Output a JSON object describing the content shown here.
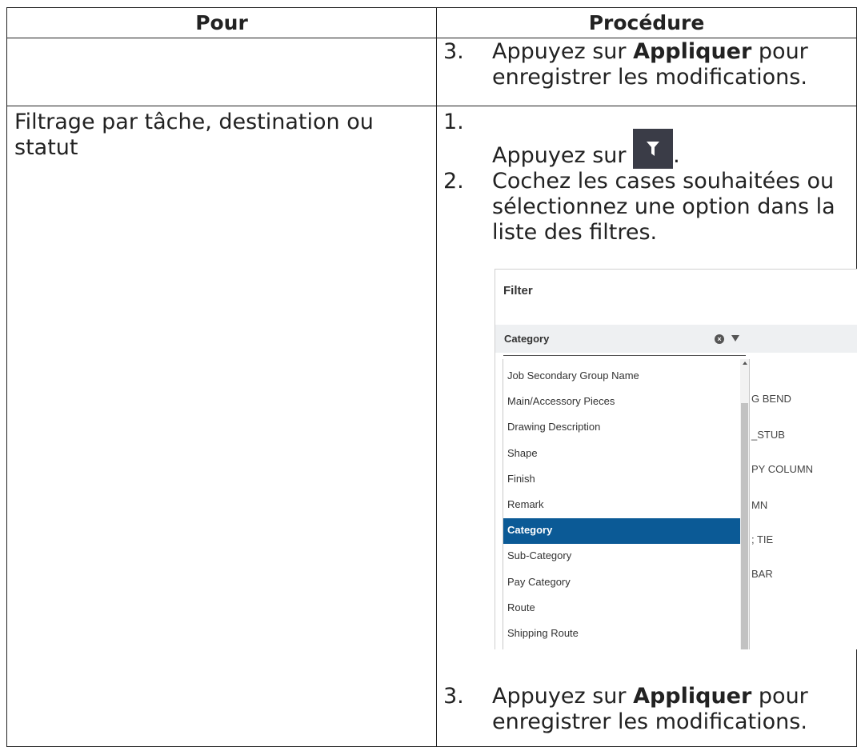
{
  "header": {
    "col1": "Pour",
    "col2": "Procédure"
  },
  "row1": {
    "step3": {
      "num": "3.",
      "prefix": "Appuyez sur ",
      "bold": "Appliquer",
      "suffix": " pour enregistrer les modifications."
    }
  },
  "row2": {
    "task": "Filtrage par tâche, destination ou statut",
    "step1": {
      "num": "1.",
      "prefix": "Appuyez sur ",
      "suffix": "."
    },
    "step2": {
      "num": "2.",
      "text": "Cochez les cases souhaitées ou sélectionnez une option dans la liste des filtres."
    },
    "step3": {
      "num": "3.",
      "prefix": "Appuyez sur ",
      "bold": "Appliquer",
      "suffix": " pour enregistrer les modifications."
    }
  },
  "filter_panel": {
    "title": "Filter",
    "category_label": "Category",
    "dropdown_items": [
      "Job Secondary Group Name",
      "Main/Accessory Pieces",
      "Drawing Description",
      "Shape",
      "Finish",
      "Remark",
      "Category",
      "Sub-Category",
      "Pay Category",
      "Route",
      "Shipping Route"
    ],
    "selected_item": "Category",
    "background_values": [
      "G BEND",
      "_STUB",
      "PY COLUMN",
      "MN",
      "; TIE",
      "BAR"
    ]
  },
  "icons": {
    "filter_button": "filter-icon",
    "clear": "clear-icon",
    "caret": "chevron-down-icon"
  },
  "colors": {
    "filter_button_bg": "#3a3c47",
    "selected_bg": "#0b5a96"
  }
}
